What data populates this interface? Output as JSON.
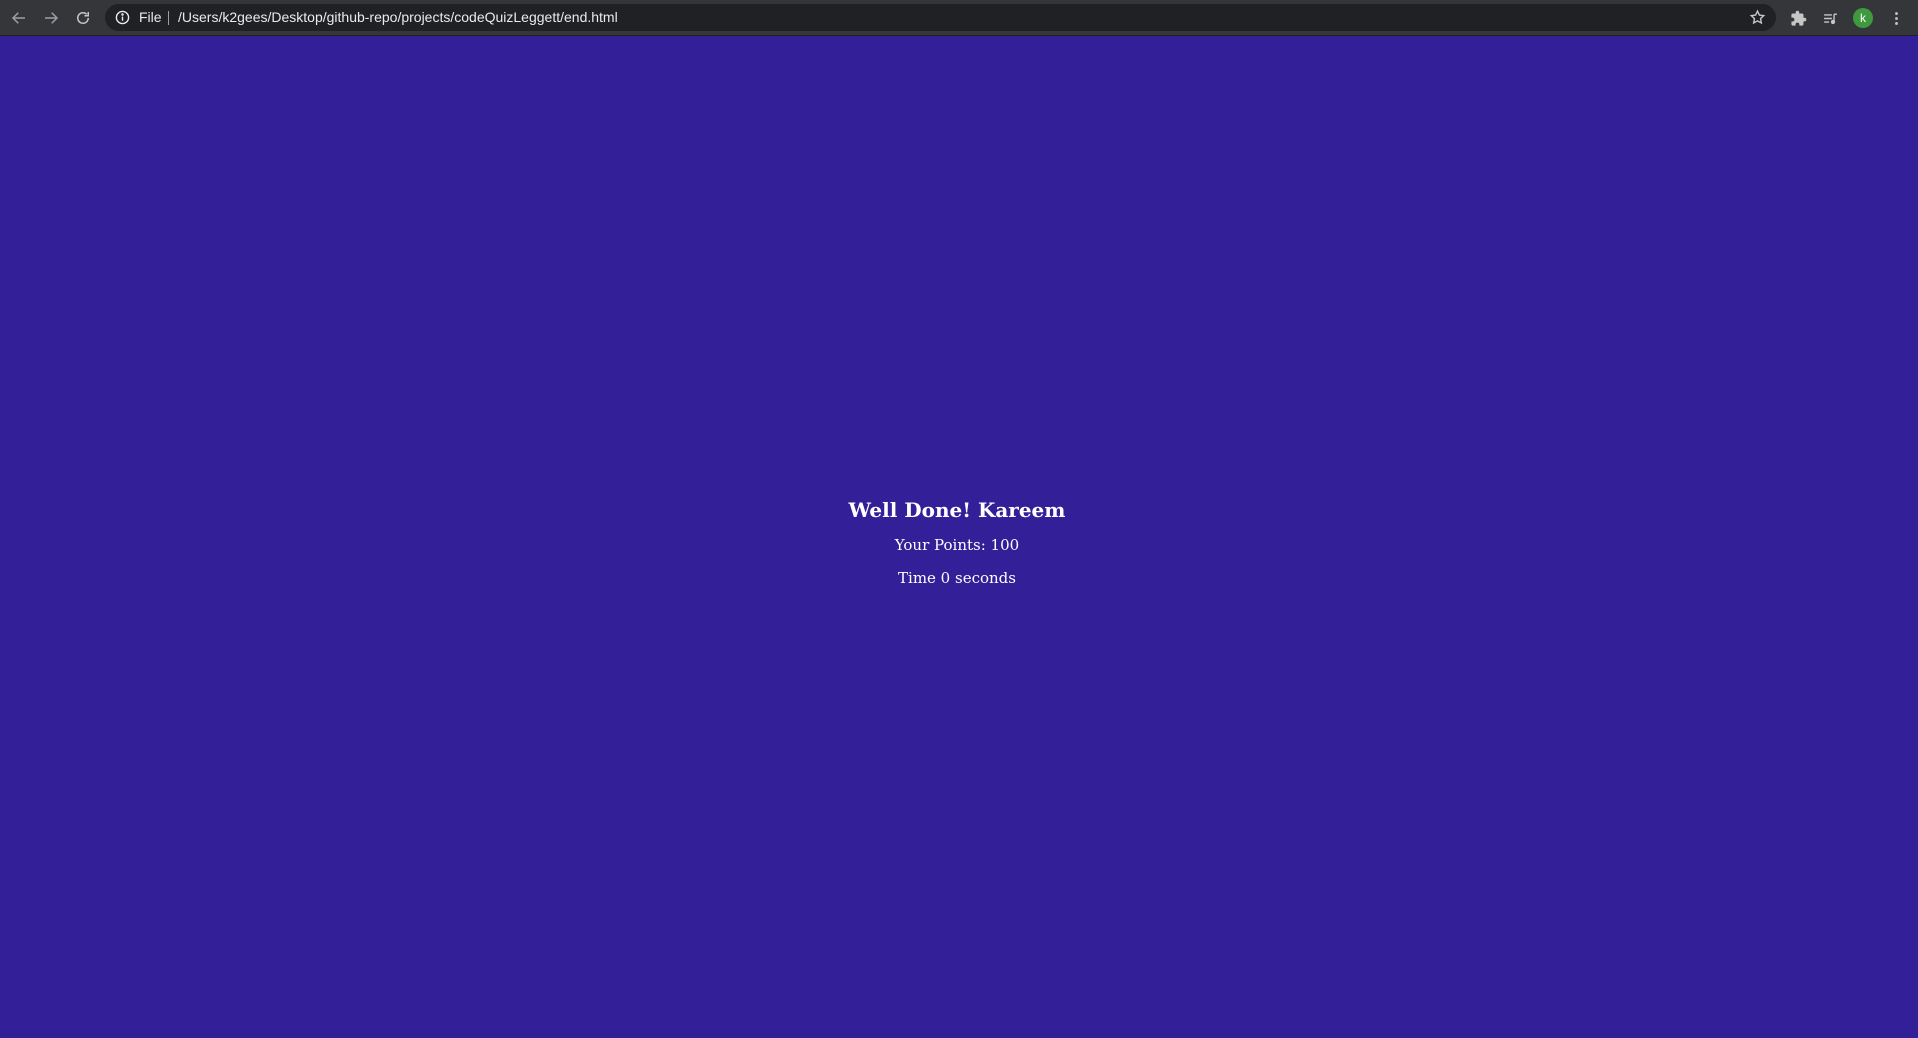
{
  "browser": {
    "scheme_label": "File",
    "url": "/Users/k2gees/Desktop/github-repo/projects/codeQuizLeggett/end.html",
    "profile_initial": "k",
    "icons": {
      "back": "back-arrow-icon",
      "forward": "forward-arrow-icon",
      "reload": "reload-icon",
      "info": "info-icon",
      "bookmark": "star-icon",
      "extensions": "puzzle-icon",
      "media": "media-queue-icon",
      "menu": "kebab-menu-icon"
    }
  },
  "page": {
    "title": "Well Done! Kareem",
    "points": "Your Points: 100",
    "time": "Time 0 seconds"
  },
  "colors": {
    "background": "#331f98",
    "toolbar": "#35363a",
    "omnibox": "#202124",
    "text": "#ffffff",
    "avatar": "#3f9a3f"
  }
}
